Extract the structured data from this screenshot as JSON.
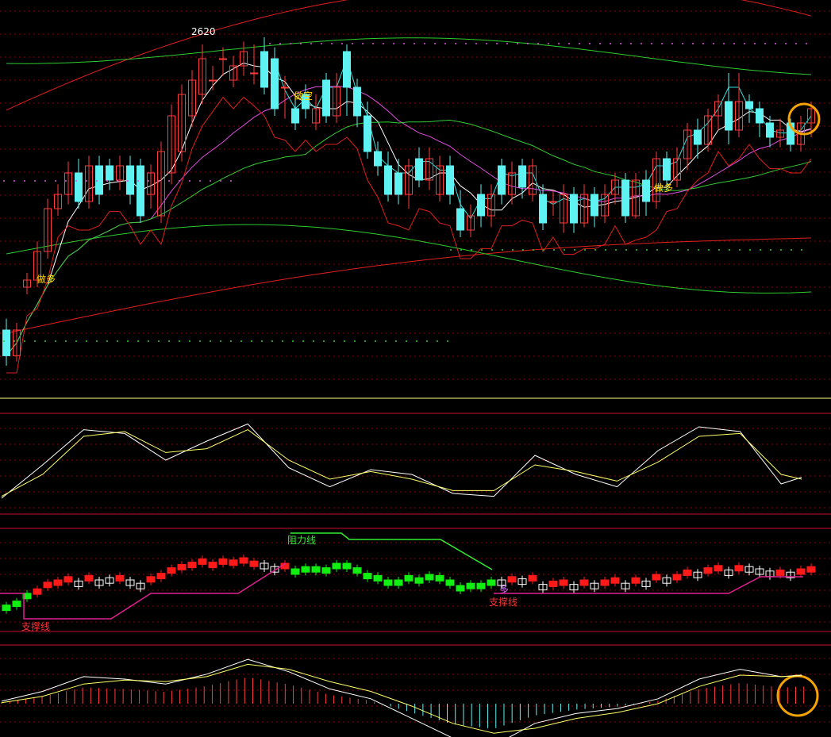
{
  "colors": {
    "background": "#000000",
    "grid": "#8b0000",
    "panel_border": "#c8102e",
    "candle_up": "#ff3b3b",
    "candle_down": "#5ff2f2",
    "ma_white": "#ffffff",
    "ma_yellow": "#ffff66",
    "ma_magenta": "#e24de2",
    "ma_green": "#33cc33",
    "band_upper": "#e0201c",
    "band_green": "#2ecc2e",
    "stop_line": "#e0201c",
    "cyan_line": "#35e0e0",
    "label_yellow": "#ffd700",
    "label_green": "#33ee33",
    "label_red": "#ff3333",
    "label_purple": "#cc66ff",
    "highlight_ring": "#f5a300",
    "bar_green": "#11ee11",
    "bar_red": "#ff1a1a"
  },
  "chart_data": [
    {
      "type": "candlestick",
      "panel": "main",
      "annotations": {
        "price_label": "2620",
        "buy_label_1": "做多",
        "sell_label": "做空",
        "buy_label_2": "做多"
      },
      "x": [
        0,
        1,
        2,
        3,
        4,
        5,
        6,
        7,
        8,
        9,
        10,
        11,
        12,
        13,
        14,
        15,
        16,
        17,
        18,
        19,
        20,
        21,
        22,
        23,
        24,
        25,
        26,
        27,
        28,
        29,
        30,
        31,
        32,
        33,
        34,
        35,
        36,
        37,
        38,
        39,
        40,
        41,
        42,
        43,
        44,
        45,
        46,
        47,
        48,
        49,
        50,
        51,
        52,
        53,
        54,
        55,
        56,
        57,
        58,
        59,
        60,
        61,
        62,
        63,
        64,
        65,
        66,
        67,
        68,
        69,
        70,
        71,
        72,
        73,
        74,
        75,
        76,
        77,
        78
      ],
      "open": [
        2420,
        2402,
        2450,
        2455,
        2475,
        2505,
        2515,
        2530,
        2510,
        2535,
        2535,
        2525,
        2535,
        2535,
        2515,
        2500,
        2530,
        2545,
        2570,
        2585,
        2595,
        2610,
        2595,
        2605,
        2600,
        2615,
        2610,
        2590,
        2575,
        2585,
        2565,
        2595,
        2570,
        2615,
        2590,
        2570,
        2545,
        2535,
        2530,
        2515,
        2540,
        2525,
        2515,
        2535,
        2505,
        2490,
        2515,
        2500,
        2535,
        2515,
        2535,
        2515,
        2515,
        2510,
        2495,
        2515,
        2495,
        2515,
        2500,
        2515,
        2525,
        2500,
        2525,
        2510,
        2540,
        2525,
        2540,
        2560,
        2550,
        2570,
        2580,
        2560,
        2580,
        2575,
        2565,
        2555,
        2565,
        2550,
        2565
      ],
      "close": [
        2402,
        2420,
        2455,
        2475,
        2505,
        2515,
        2530,
        2510,
        2535,
        2515,
        2525,
        2535,
        2515,
        2500,
        2530,
        2545,
        2570,
        2585,
        2595,
        2610,
        2595,
        2610,
        2605,
        2615,
        2600,
        2590,
        2575,
        2590,
        2565,
        2575,
        2575,
        2570,
        2590,
        2590,
        2570,
        2545,
        2535,
        2515,
        2515,
        2535,
        2525,
        2540,
        2535,
        2515,
        2490,
        2500,
        2500,
        2515,
        2515,
        2530,
        2520,
        2535,
        2495,
        2510,
        2515,
        2495,
        2515,
        2500,
        2515,
        2525,
        2500,
        2525,
        2510,
        2540,
        2525,
        2540,
        2560,
        2550,
        2570,
        2580,
        2560,
        2580,
        2575,
        2565,
        2555,
        2560,
        2550,
        2565,
        2575
      ],
      "high": [
        2428,
        2425,
        2460,
        2482,
        2512,
        2522,
        2538,
        2540,
        2542,
        2542,
        2540,
        2542,
        2542,
        2540,
        2536,
        2552,
        2578,
        2592,
        2602,
        2620,
        2605,
        2618,
        2612,
        2622,
        2620,
        2625,
        2618,
        2598,
        2585,
        2592,
        2585,
        2600,
        2600,
        2620,
        2596,
        2580,
        2552,
        2545,
        2540,
        2540,
        2548,
        2548,
        2542,
        2542,
        2518,
        2508,
        2522,
        2522,
        2540,
        2538,
        2540,
        2540,
        2522,
        2518,
        2522,
        2520,
        2522,
        2520,
        2522,
        2530,
        2530,
        2530,
        2532,
        2545,
        2545,
        2548,
        2565,
        2568,
        2575,
        2585,
        2600,
        2600,
        2585,
        2580,
        2570,
        2568,
        2568,
        2570,
        2580
      ],
      "low": [
        2395,
        2398,
        2445,
        2450,
        2470,
        2500,
        2508,
        2505,
        2505,
        2508,
        2518,
        2518,
        2508,
        2495,
        2505,
        2495,
        2522,
        2538,
        2562,
        2578,
        2588,
        2598,
        2590,
        2598,
        2592,
        2585,
        2570,
        2568,
        2560,
        2568,
        2560,
        2565,
        2565,
        2570,
        2562,
        2540,
        2528,
        2510,
        2508,
        2505,
        2520,
        2518,
        2510,
        2508,
        2485,
        2485,
        2492,
        2492,
        2508,
        2508,
        2512,
        2510,
        2490,
        2500,
        2488,
        2488,
        2492,
        2492,
        2495,
        2508,
        2495,
        2498,
        2500,
        2505,
        2518,
        2520,
        2532,
        2540,
        2545,
        2560,
        2550,
        2555,
        2565,
        2555,
        2548,
        2548,
        2545,
        2545,
        2555
      ]
    },
    {
      "type": "line",
      "panel": "oscillator",
      "x": [
        0,
        4,
        8,
        12,
        16,
        20,
        24,
        28,
        32,
        36,
        40,
        44,
        48,
        52,
        56,
        60,
        64,
        68,
        72,
        76,
        78
      ],
      "series": [
        {
          "color": "white",
          "values": [
            0.1,
            0.45,
            0.82,
            0.78,
            0.5,
            0.7,
            0.88,
            0.42,
            0.22,
            0.4,
            0.35,
            0.15,
            0.12,
            0.55,
            0.35,
            0.22,
            0.6,
            0.85,
            0.8,
            0.25,
            0.32
          ]
        },
        {
          "color": "yellow",
          "values": [
            0.12,
            0.35,
            0.75,
            0.8,
            0.58,
            0.62,
            0.82,
            0.5,
            0.3,
            0.38,
            0.3,
            0.18,
            0.18,
            0.45,
            0.38,
            0.28,
            0.48,
            0.75,
            0.78,
            0.35,
            0.3
          ]
        }
      ]
    },
    {
      "type": "bar",
      "panel": "trend",
      "labels": {
        "resistance": "阻力线",
        "support_1": "支撑线",
        "support_2": "支撑线",
        "long": "多"
      }
    },
    {
      "type": "bar",
      "panel": "macd",
      "x": [
        0,
        4,
        8,
        12,
        16,
        20,
        24,
        28,
        32,
        36,
        40,
        44,
        48,
        52,
        56,
        60,
        64,
        68,
        72,
        76,
        78
      ],
      "series": [
        {
          "color": "white",
          "values": [
            0.05,
            0.25,
            0.55,
            0.5,
            0.4,
            0.6,
            0.9,
            0.65,
            0.3,
            0.1,
            -0.3,
            -0.7,
            -0.85,
            -0.4,
            -0.2,
            -0.1,
            0.1,
            0.5,
            0.7,
            0.55,
            0.58
          ]
        },
        {
          "color": "yellow",
          "values": [
            0.02,
            0.15,
            0.4,
            0.48,
            0.45,
            0.55,
            0.8,
            0.7,
            0.45,
            0.25,
            -0.05,
            -0.4,
            -0.6,
            -0.5,
            -0.3,
            -0.18,
            0.0,
            0.35,
            0.58,
            0.55,
            0.57
          ]
        }
      ]
    }
  ]
}
